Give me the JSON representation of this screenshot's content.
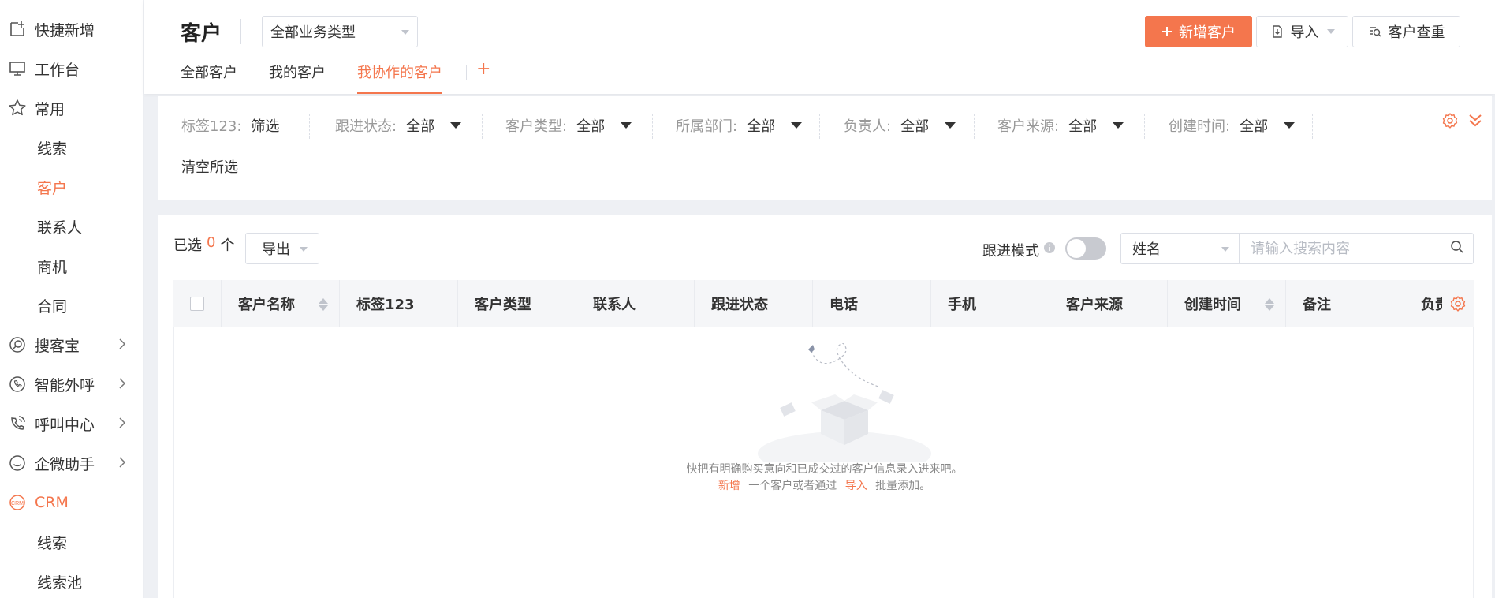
{
  "sidebar": {
    "items": [
      {
        "label": "快捷新增",
        "icon": "quick-add-icon"
      },
      {
        "label": "工作台",
        "icon": "monitor-icon"
      },
      {
        "label": "常用",
        "icon": "star-icon"
      },
      {
        "label": "线索"
      },
      {
        "label": "客户"
      },
      {
        "label": "联系人"
      },
      {
        "label": "商机"
      },
      {
        "label": "合同"
      },
      {
        "label": "搜客宝",
        "icon": "search-treasure-icon"
      },
      {
        "label": "智能外呼",
        "icon": "phone-icon"
      },
      {
        "label": "呼叫中心",
        "icon": "call-center-icon"
      },
      {
        "label": "企微助手",
        "icon": "wecom-icon"
      },
      {
        "label": "CRM",
        "icon": "crm-icon"
      },
      {
        "label": "线索"
      },
      {
        "label": "线索池"
      }
    ]
  },
  "header": {
    "title": "客户",
    "type_select": "全部业务类型",
    "tabs": [
      "全部客户",
      "我的客户",
      "我协作的客户"
    ],
    "add_tab": "+",
    "buttons": {
      "new_customer": "新增客户",
      "import": "导入",
      "dup_check": "客户查重"
    }
  },
  "filters": {
    "items": [
      {
        "label": "标签123:",
        "value": "筛选"
      },
      {
        "label": "跟进状态:",
        "value": "全部"
      },
      {
        "label": "客户类型:",
        "value": "全部"
      },
      {
        "label": "所属部门:",
        "value": "全部"
      },
      {
        "label": "负责人:",
        "value": "全部"
      },
      {
        "label": "客户来源:",
        "value": "全部"
      },
      {
        "label": "创建时间:",
        "value": "全部"
      }
    ],
    "clear": "清空所选"
  },
  "list": {
    "selected_prefix": "已选",
    "selected_count": "0",
    "selected_suffix": "个",
    "export": "导出",
    "follow_mode": "跟进模式",
    "field_select": "姓名",
    "search_placeholder": "请输入搜索内容",
    "columns": [
      "客户名称",
      "标签123",
      "客户类型",
      "联系人",
      "跟进状态",
      "电话",
      "手机",
      "客户来源",
      "创建时间",
      "备注",
      "负责"
    ],
    "empty": {
      "line1": "快把有明确购买意向和已成交过的客户信息录入进来吧。",
      "new_link": "新增",
      "mid": "一个客户或者通过",
      "import_link": "导入",
      "tail": "批量添加。"
    }
  },
  "colors": {
    "accent": "#f4764d"
  }
}
